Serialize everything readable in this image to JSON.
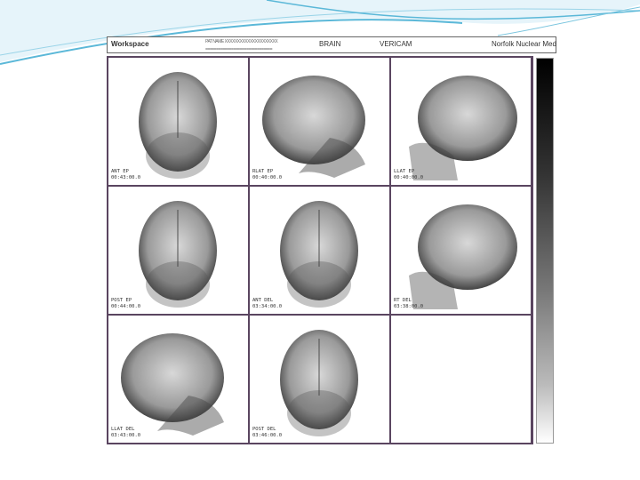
{
  "header": {
    "workspace": "Workspace",
    "study": "BRAIN",
    "camera": "VERICAM",
    "site": "Norfolk Nuclear Med",
    "garbled_line1": "PAT NAME XXXXXXXXXXXXXXXXXXXXX",
    "garbled_line2": "==============================="
  },
  "cells": [
    {
      "view": "ANT EP",
      "time": "00:43:00.0",
      "kind": "front"
    },
    {
      "view": "RLAT EP",
      "time": "00:40:00.0",
      "kind": "right"
    },
    {
      "view": "LLAT EP",
      "time": "00:40:00.0",
      "kind": "left"
    },
    {
      "view": "POST EP",
      "time": "00:44:00.0",
      "kind": "front"
    },
    {
      "view": "ANT DEL",
      "time": "03:34:00.0",
      "kind": "front"
    },
    {
      "view": "RT DEL",
      "time": "03:38:00.0",
      "kind": "left"
    },
    {
      "view": "LLAT DEL",
      "time": "03:43:00.0",
      "kind": "right"
    },
    {
      "view": "POST DEL",
      "time": "03:46:00.0",
      "kind": "front"
    },
    {
      "view": "",
      "time": "",
      "kind": "empty"
    }
  ],
  "colors": {
    "grid_border": "#5a4560",
    "swoosh": "#5bb8d8"
  }
}
